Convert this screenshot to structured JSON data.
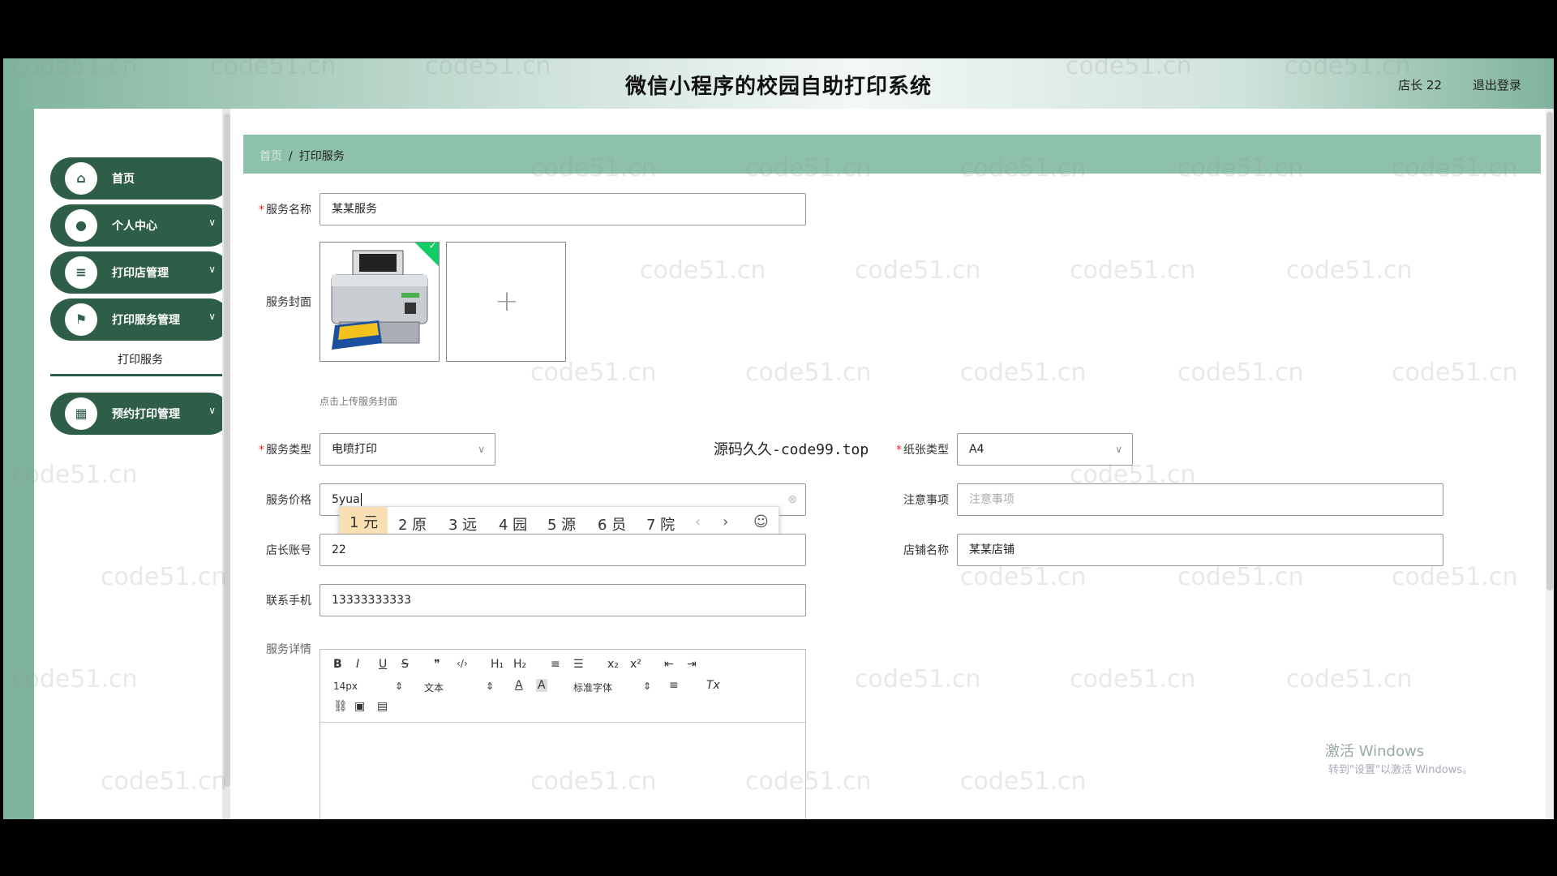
{
  "header": {
    "app_title": "微信小程序的校园自助打印系统",
    "user": "店长 22",
    "logout": "退出登录"
  },
  "sidebar": {
    "items": [
      {
        "label": "首页",
        "icon": "home-icon"
      },
      {
        "label": "个人中心",
        "icon": "user-icon"
      },
      {
        "label": "打印店管理",
        "icon": "sliders-icon"
      },
      {
        "label": "打印服务管理",
        "icon": "flag-icon"
      },
      {
        "label": "预约打印管理",
        "icon": "grid-icon"
      }
    ],
    "submenu": "打印服务"
  },
  "breadcrumb": {
    "home": "首页",
    "separator": "/",
    "current": "打印服务"
  },
  "form": {
    "service_name": {
      "label": "服务名称",
      "value": "某某服务"
    },
    "cover": {
      "label": "服务封面",
      "hint": "点击上传服务封面"
    },
    "service_type": {
      "label": "服务类型",
      "value": "电喷打印"
    },
    "paper_type": {
      "label": "纸张类型",
      "value": "A4"
    },
    "price": {
      "label": "服务价格",
      "value": "5yua"
    },
    "notes": {
      "label": "注意事项",
      "placeholder": "注意事项"
    },
    "owner_account": {
      "label": "店长账号",
      "value": "22"
    },
    "shop_name": {
      "label": "店铺名称",
      "value": "某某店铺"
    },
    "phone": {
      "label": "联系手机",
      "value": "13333333333"
    },
    "detail": {
      "label": "服务详情"
    }
  },
  "ime": {
    "candidates": [
      "1 元",
      "2 原",
      "3 远",
      "4 园",
      "5 源",
      "6 员",
      "7 院"
    ],
    "prev": "‹",
    "next": "›",
    "emoji": "☺"
  },
  "editor": {
    "row1": [
      "B",
      "I",
      "U",
      "S",
      "❞",
      "‹/›",
      "H₁",
      "H₂",
      "≡",
      "☰",
      "x₂",
      "x²",
      "⇤",
      "⇥"
    ],
    "font_size": "14px",
    "paragraph": "文本",
    "font_color": "A",
    "bg_color": "A",
    "font_family": "标准字体",
    "align": "≡",
    "clear": "Tx",
    "row3": [
      "⛓",
      "▣",
      "▤"
    ]
  },
  "overlay": {
    "site_watermark": "源码久久-code99.top",
    "windows_line1": "激活 Windows",
    "windows_line2": "转到\"设置\"以激活 Windows。",
    "page_watermark": "code51.cn"
  },
  "colors": {
    "accent": "#2e5e48",
    "header_green": "#7fb39d",
    "breadcrumb_bg": "#8ec1a9"
  }
}
